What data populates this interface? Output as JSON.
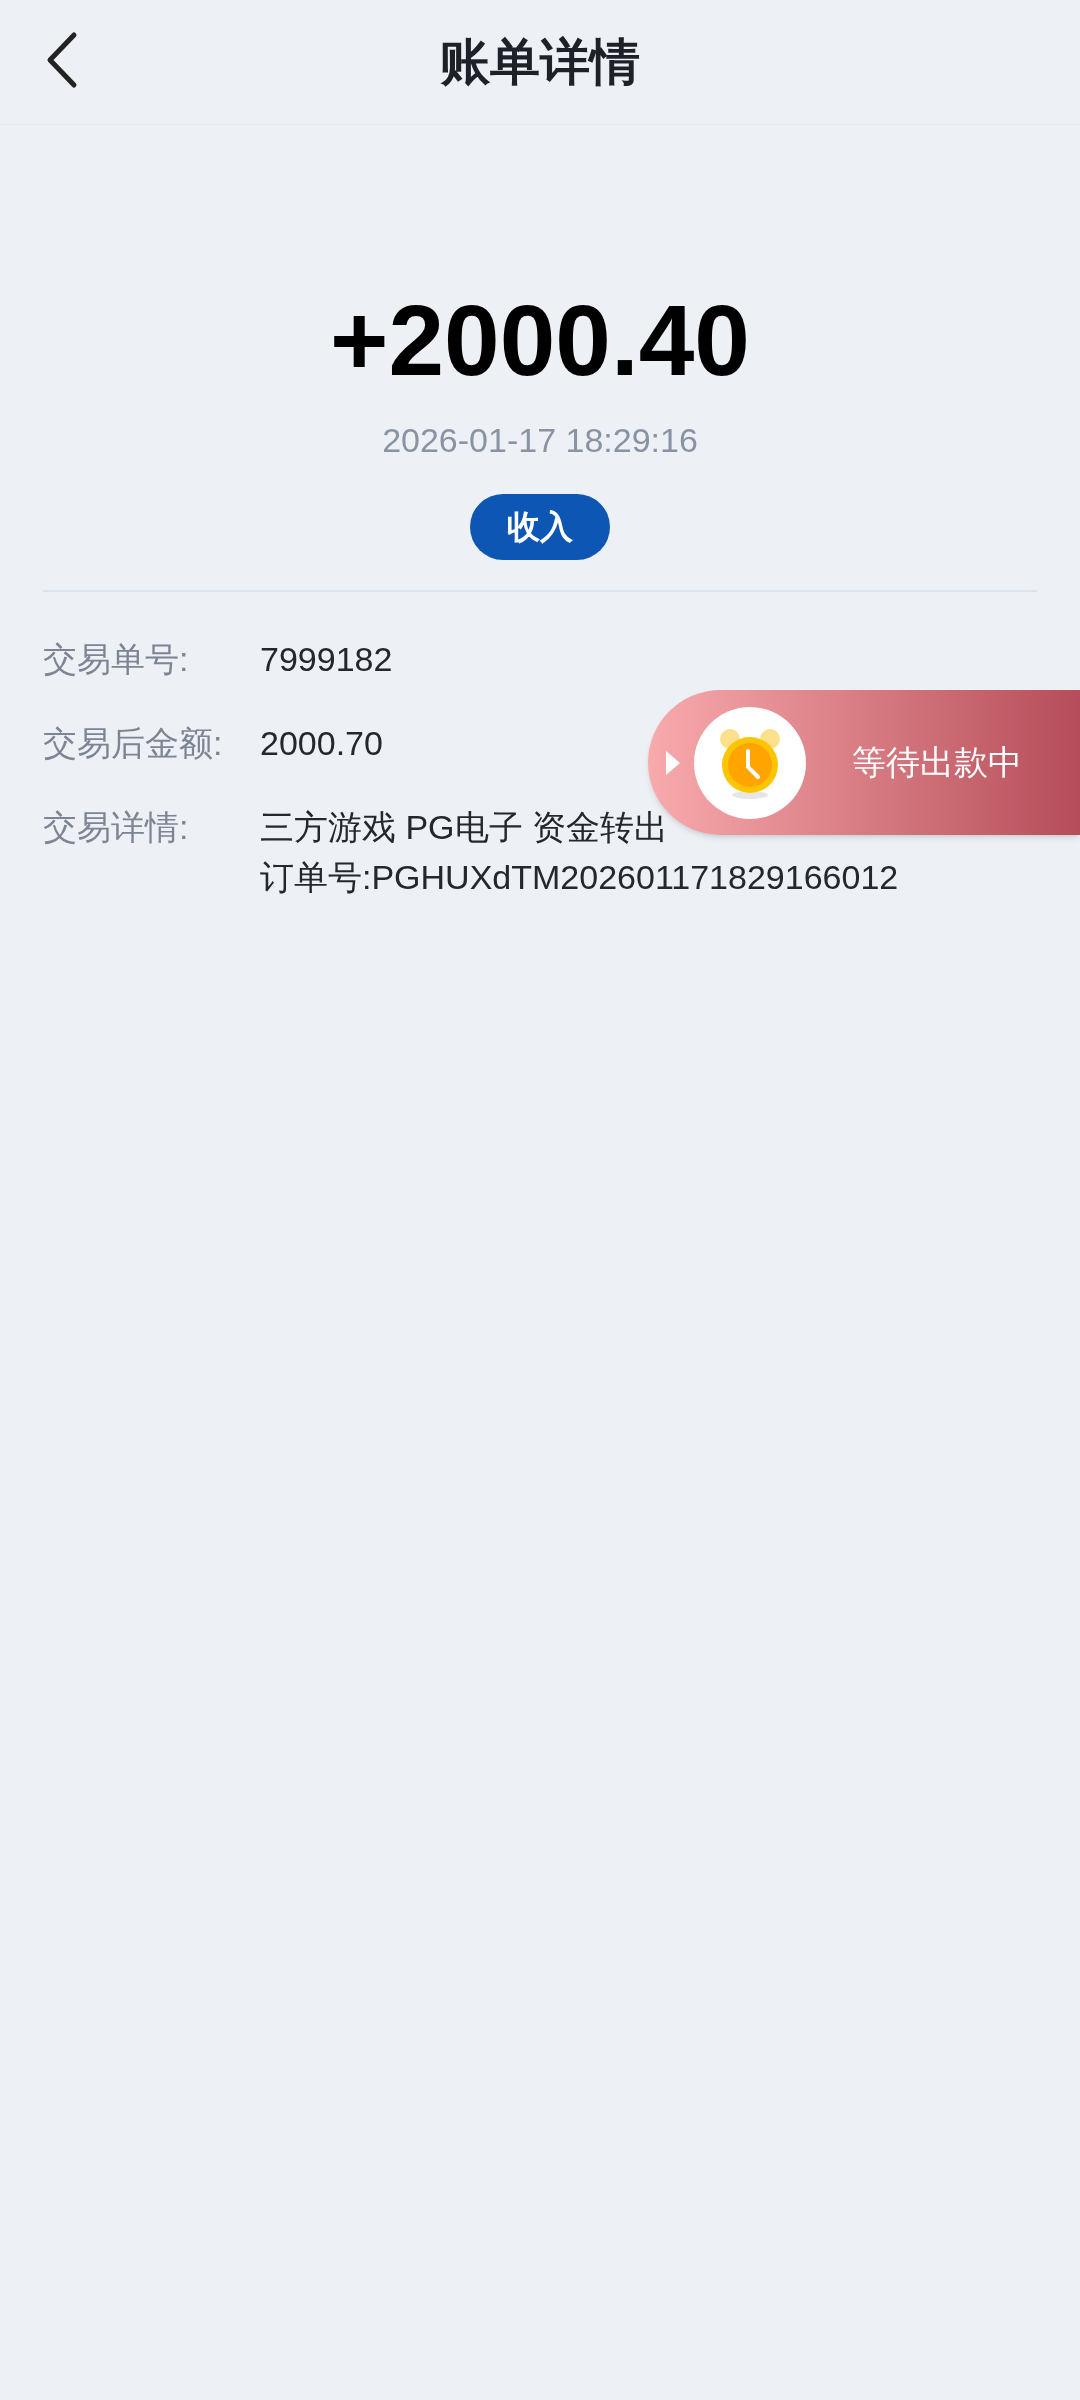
{
  "header": {
    "title": "账单详情"
  },
  "amount": "+2000.40",
  "time": "2026-01-17 18:29:16",
  "badge": "收入",
  "details": [
    {
      "label": "交易单号:",
      "lines": [
        "7999182"
      ]
    },
    {
      "label": "交易后金额:",
      "lines": [
        "2000.70"
      ]
    },
    {
      "label": "交易详情:",
      "lines": [
        "三方游戏 PG电子 资金转出",
        "订单号:PGHUXdTM202601171829166012"
      ]
    }
  ],
  "floating_status": {
    "label": "等待出款中"
  }
}
